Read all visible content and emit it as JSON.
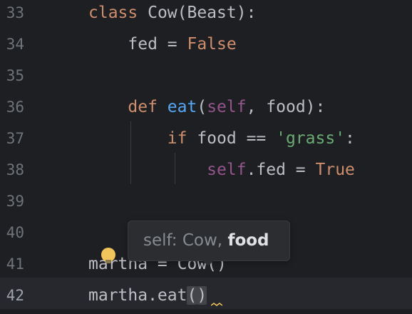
{
  "gutter": {
    "line_numbers": [
      "33",
      "34",
      "35",
      "36",
      "37",
      "38",
      "39",
      "40",
      "41",
      "42"
    ],
    "current_line": "42"
  },
  "code": {
    "l33": {
      "kw": "class",
      "rest": " Cow(Beast):"
    },
    "l34": {
      "indent": "    ",
      "name": "fed",
      "op": " = ",
      "value": "False"
    },
    "l36": {
      "indent": "    ",
      "kw": "def",
      "space": " ",
      "fn": "eat",
      "open": "(",
      "self": "self",
      "rest": ", food):"
    },
    "l37": {
      "indent": "        ",
      "kw": "if",
      "mid": " food == ",
      "str": "'grass'",
      "end": ":"
    },
    "l38": {
      "indent": "            ",
      "self": "self",
      "mid": ".fed = ",
      "value": "True"
    },
    "l41": {
      "text": "martha = Cow()"
    },
    "l42": {
      "prefix": "martha.eat",
      "open": "(",
      "close": ")"
    }
  },
  "tooltip": {
    "dim_part": "self: Cow, ",
    "active_part": "food"
  },
  "colors": {
    "background": "#1e1f22",
    "keyword": "#cf8e6d",
    "function": "#56a8f5",
    "self": "#94558d",
    "string": "#6aab73",
    "text": "#bcbec4",
    "line_number": "#6f737a",
    "bulb": "#f2c55c"
  },
  "icons": {
    "intention": "lightbulb-icon",
    "squiggle": "warning-squiggle-icon"
  }
}
